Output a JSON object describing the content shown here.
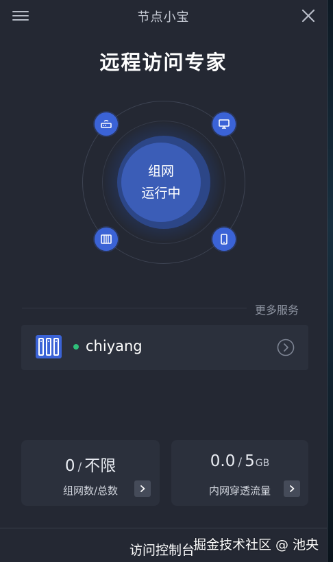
{
  "titlebar": {
    "title": "节点小宝",
    "icons": {
      "menu": "hamburger-menu-icon",
      "close": "close-icon"
    }
  },
  "headline": "远程访问专家",
  "hero": {
    "status_line1": "组网",
    "status_line2": "运行中",
    "node_icons": [
      "router-icon",
      "desktop-icon",
      "server-rack-icon",
      "phone-icon"
    ],
    "accent_color": "#3b63d6"
  },
  "more_services": "更多服务",
  "device": {
    "name": "chiyang",
    "online": true,
    "status_color": "#2fbf7a",
    "icon": "server-rack-icon"
  },
  "stats": {
    "network": {
      "current": "0",
      "sep": "/",
      "limit": "不限",
      "label": "组网数/总数"
    },
    "traffic": {
      "current": "0.0",
      "sep": "/",
      "limit": "5",
      "unit": "GB",
      "label": "内网穿透流量"
    }
  },
  "footer": {
    "console": "访问控制台",
    "watermark": "掘金技术社区 @ 池央"
  }
}
